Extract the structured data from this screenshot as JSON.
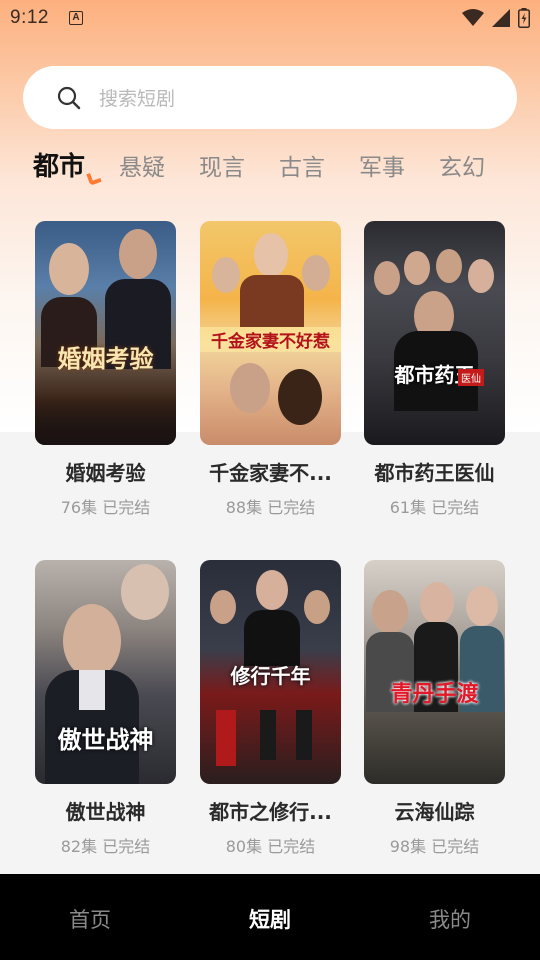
{
  "status": {
    "time": "9:12",
    "notif_letter": "A"
  },
  "search": {
    "placeholder": "搜索短剧"
  },
  "tabs": [
    {
      "label": "都市",
      "active": true
    },
    {
      "label": "悬疑",
      "active": false
    },
    {
      "label": "现言",
      "active": false
    },
    {
      "label": "古言",
      "active": false
    },
    {
      "label": "军事",
      "active": false
    },
    {
      "label": "玄幻",
      "active": false
    }
  ],
  "dramas": [
    {
      "title": "婚姻考验",
      "poster_text": "婚姻考验",
      "episodes": "76集",
      "status": "已完结"
    },
    {
      "title": "千金家妻不...",
      "poster_text": "千金家妻不好惹",
      "episodes": "88集",
      "status": "已完结"
    },
    {
      "title": "都市药王医仙",
      "poster_text": "都市药王",
      "poster_badge": "医仙",
      "episodes": "61集",
      "status": "已完结"
    },
    {
      "title": "傲世战神",
      "poster_text": "傲世战神",
      "episodes": "82集",
      "status": "已完结"
    },
    {
      "title": "都市之修行...",
      "poster_text": "修行千年",
      "episodes": "80集",
      "status": "已完结"
    },
    {
      "title": "云海仙踪",
      "poster_text": "青丹手渡",
      "episodes": "98集",
      "status": "已完结"
    }
  ],
  "bottom_nav": [
    {
      "label": "首页",
      "active": false
    },
    {
      "label": "短剧",
      "active": true
    },
    {
      "label": "我的",
      "active": false
    }
  ],
  "colors": {
    "accent": "#ff7a2e",
    "nav_bg": "#000000"
  },
  "icons": [
    "search-icon",
    "wifi-icon",
    "signal-icon",
    "battery-icon"
  ]
}
